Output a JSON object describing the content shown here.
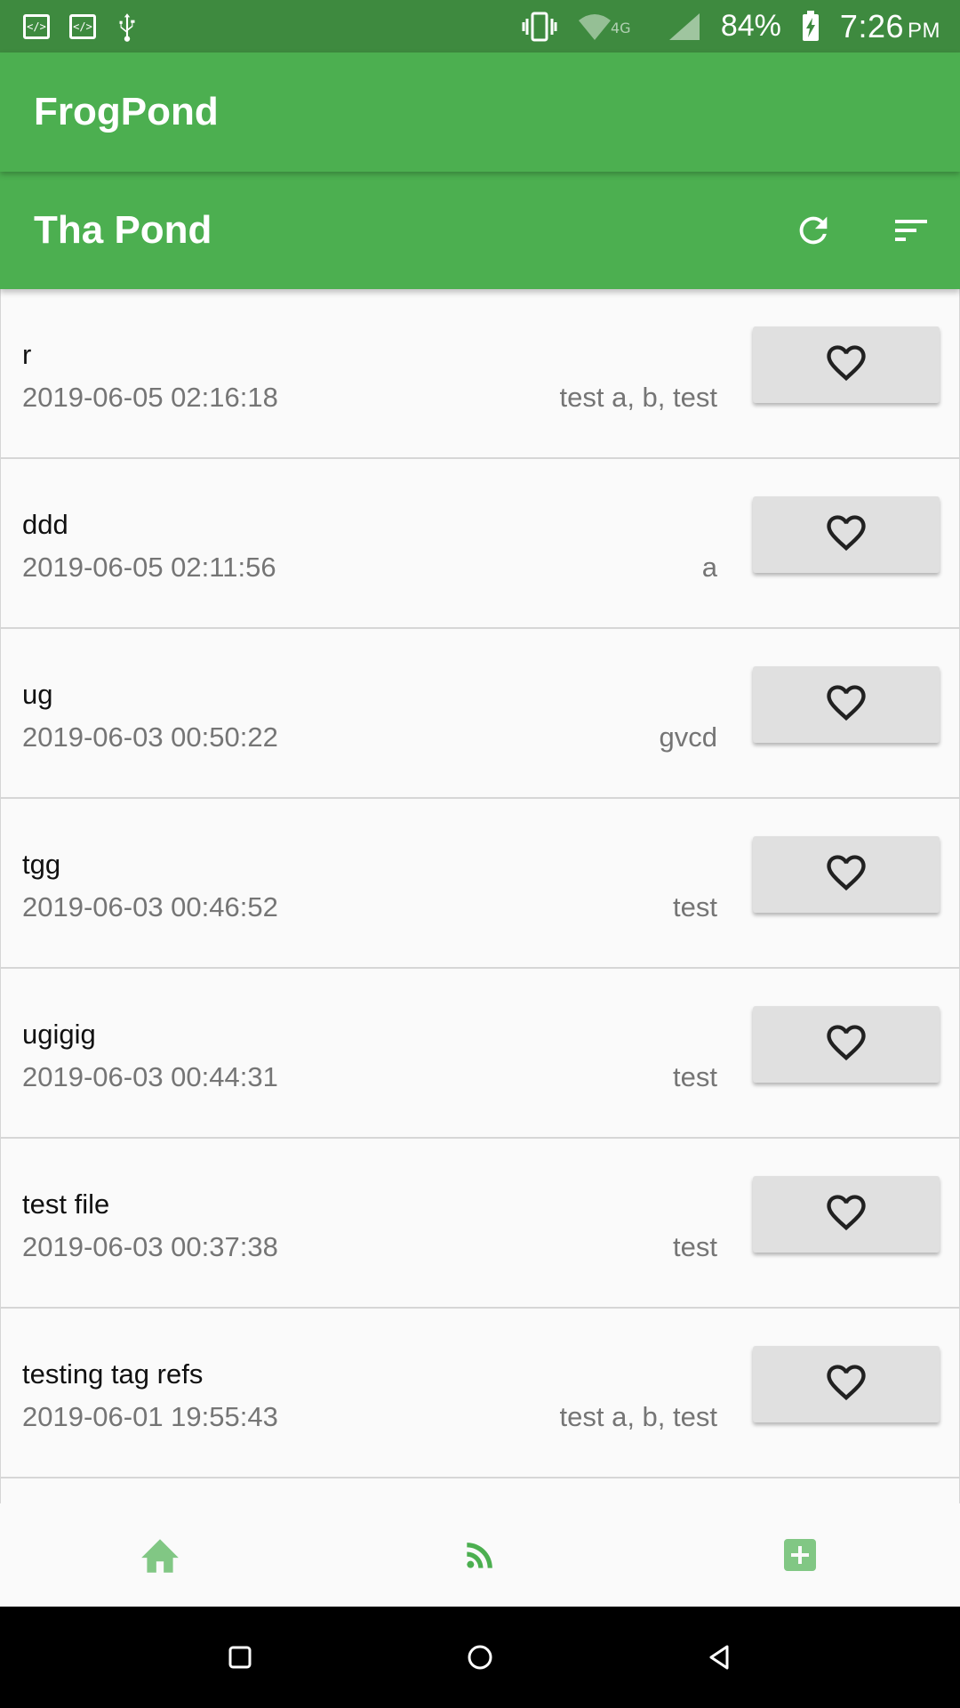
{
  "status_bar": {
    "battery_percent": "84%",
    "time": "7:26",
    "ampm": "PM",
    "network": "4G",
    "icons": [
      "code-icon",
      "code-icon",
      "usb-icon",
      "vibrate-icon",
      "wifi-icon",
      "signal-icon",
      "battery-charging-icon"
    ]
  },
  "app_bar": {
    "title": "FrogPond"
  },
  "section": {
    "title": "Tha Pond",
    "actions": [
      "refresh-icon",
      "sort-icon"
    ]
  },
  "posts": [
    {
      "title": "r",
      "date": "2019-06-05 02:16:18",
      "tags": "test a, b, test"
    },
    {
      "title": "ddd",
      "date": "2019-06-05 02:11:56",
      "tags": "a"
    },
    {
      "title": "ug",
      "date": "2019-06-03 00:50:22",
      "tags": "gvcd"
    },
    {
      "title": "tgg",
      "date": "2019-06-03 00:46:52",
      "tags": "test"
    },
    {
      "title": "ugigig",
      "date": "2019-06-03 00:44:31",
      "tags": "test"
    },
    {
      "title": "test file",
      "date": "2019-06-03 00:37:38",
      "tags": "test"
    },
    {
      "title": "testing tag refs",
      "date": "2019-06-01 19:55:43",
      "tags": "test a, b, test"
    }
  ],
  "bottom_nav": {
    "items": [
      "home-icon",
      "feed-icon",
      "add-box-icon"
    ],
    "active_color": "#4caf50",
    "inactive_color": "#81c784"
  },
  "colors": {
    "primary": "#4caf50",
    "status_bar": "#3e8a3f",
    "button_bg": "#e0e0e0",
    "secondary_text": "#757575"
  }
}
